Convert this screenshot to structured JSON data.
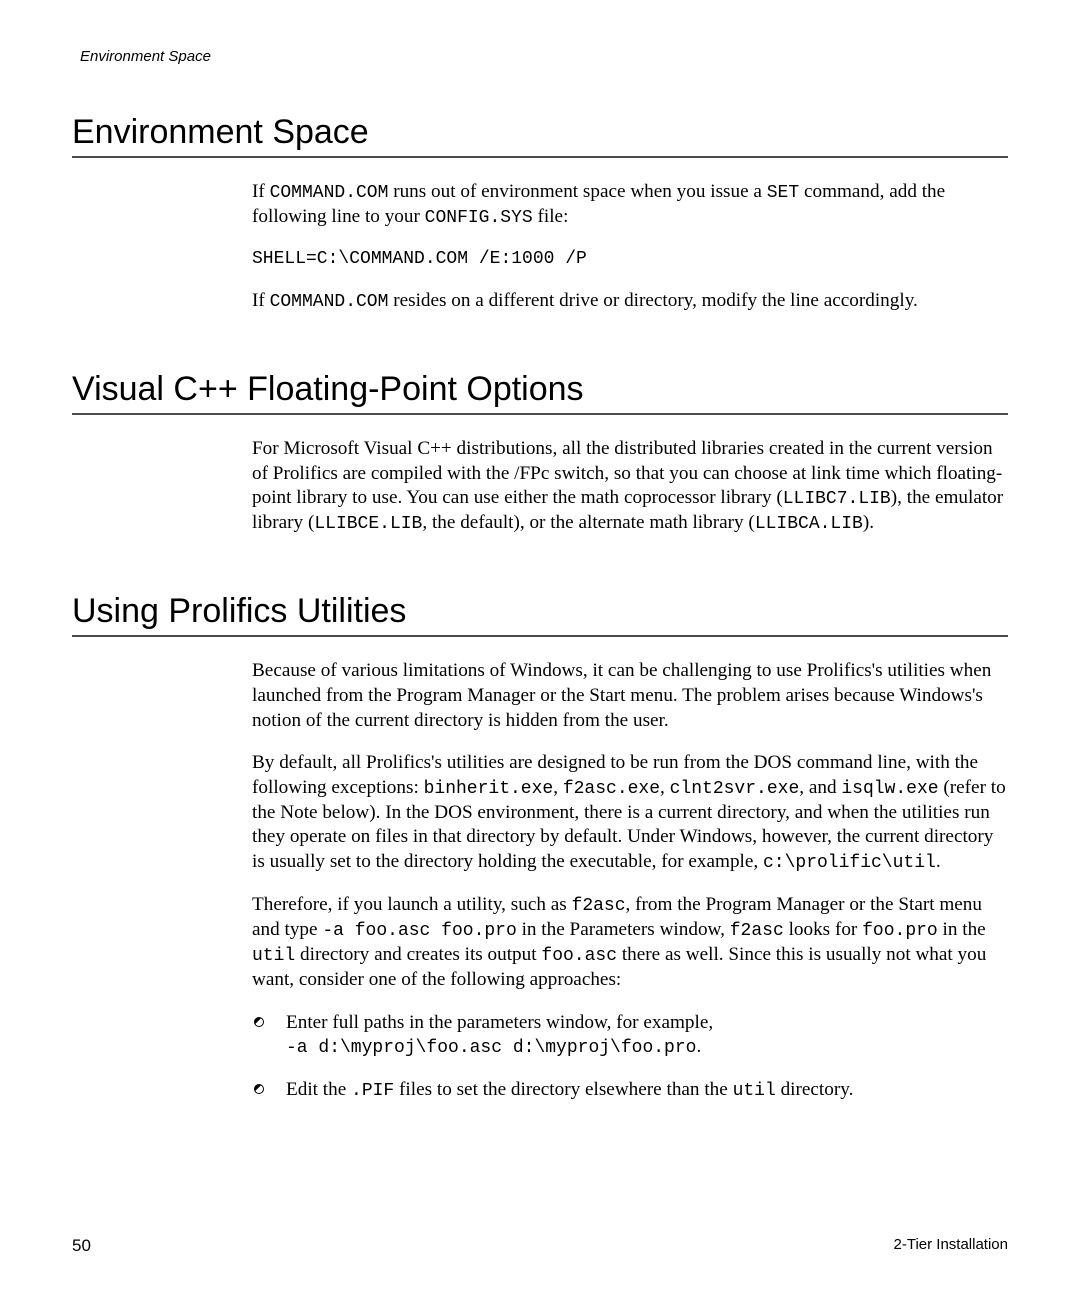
{
  "header": {
    "running": "Environment Space"
  },
  "sections": [
    {
      "title": "Environment Space",
      "paras": [
        {
          "html": "If <code>COMMAND.COM</code> runs out of environment space when you issue a <code>SET</code> command, add the following line to your <code>CONFIG.SYS</code> file:"
        },
        {
          "code": "SHELL=C:\\COMMAND.COM /E:1000 /P"
        },
        {
          "html": "If <code>COMMAND.COM</code> resides on a different drive or directory, modify the line accordingly."
        }
      ]
    },
    {
      "title": "Visual C++ Floating-Point Options",
      "paras": [
        {
          "html": "For Microsoft Visual C++ distributions, all the distributed libraries created in the current version of Prolifics are compiled with the /FPc switch, so that you can choose at link time which floating-point library to use. You can use either the math coprocessor library (<code>LLIBC7.LIB</code>), the emulator library (<code>LLIBCE.LIB</code>, the default), or the alternate math library (<code>LLIBCA.LIB</code>)."
        }
      ]
    },
    {
      "title": "Using Prolifics Utilities",
      "paras": [
        {
          "html": "Because of various limitations of Windows, it can be challenging to use Prolifics's utilities when launched from the Program Manager or the Start menu. The problem arises because Windows's notion of the current directory is hidden from the user."
        },
        {
          "html": "By default, all Prolifics's utilities are designed to be run from the DOS command line, with the following exceptions: <code>binherit.exe</code>, <code>f2asc.exe</code>, <code>clnt2svr.exe</code>, and <code>isqlw.exe</code> (refer to the Note below). In the DOS environment, there is a current directory, and when the utilities run they operate on files in that directory by default. Under Windows, however, the current directory is usually set to the directory holding the executable, for example, <code>c:\\prolific\\util</code>."
        },
        {
          "html": "Therefore, if you launch a utility, such as <code>f2asc</code>, from the Program Manager or the Start menu and type <code>-a foo.asc foo.pro</code> in the Parameters window, <code>f2asc</code> looks for <code>foo.pro</code> in the <code>util</code> directory and creates its output <code>foo.asc</code> there as well. Since this is usually not what you want, consider one of the following approaches:"
        }
      ],
      "bullets": [
        {
          "html": "Enter full paths in the parameters window, for example,<br><code>-a d:\\myproj\\foo.asc d:\\myproj\\foo.pro</code>."
        },
        {
          "html": "Edit the <code>.PIF</code> files to set the directory elsewhere than the <code>util</code> directory."
        }
      ]
    }
  ],
  "footer": {
    "page": "50",
    "label": "2-Tier Installation"
  }
}
